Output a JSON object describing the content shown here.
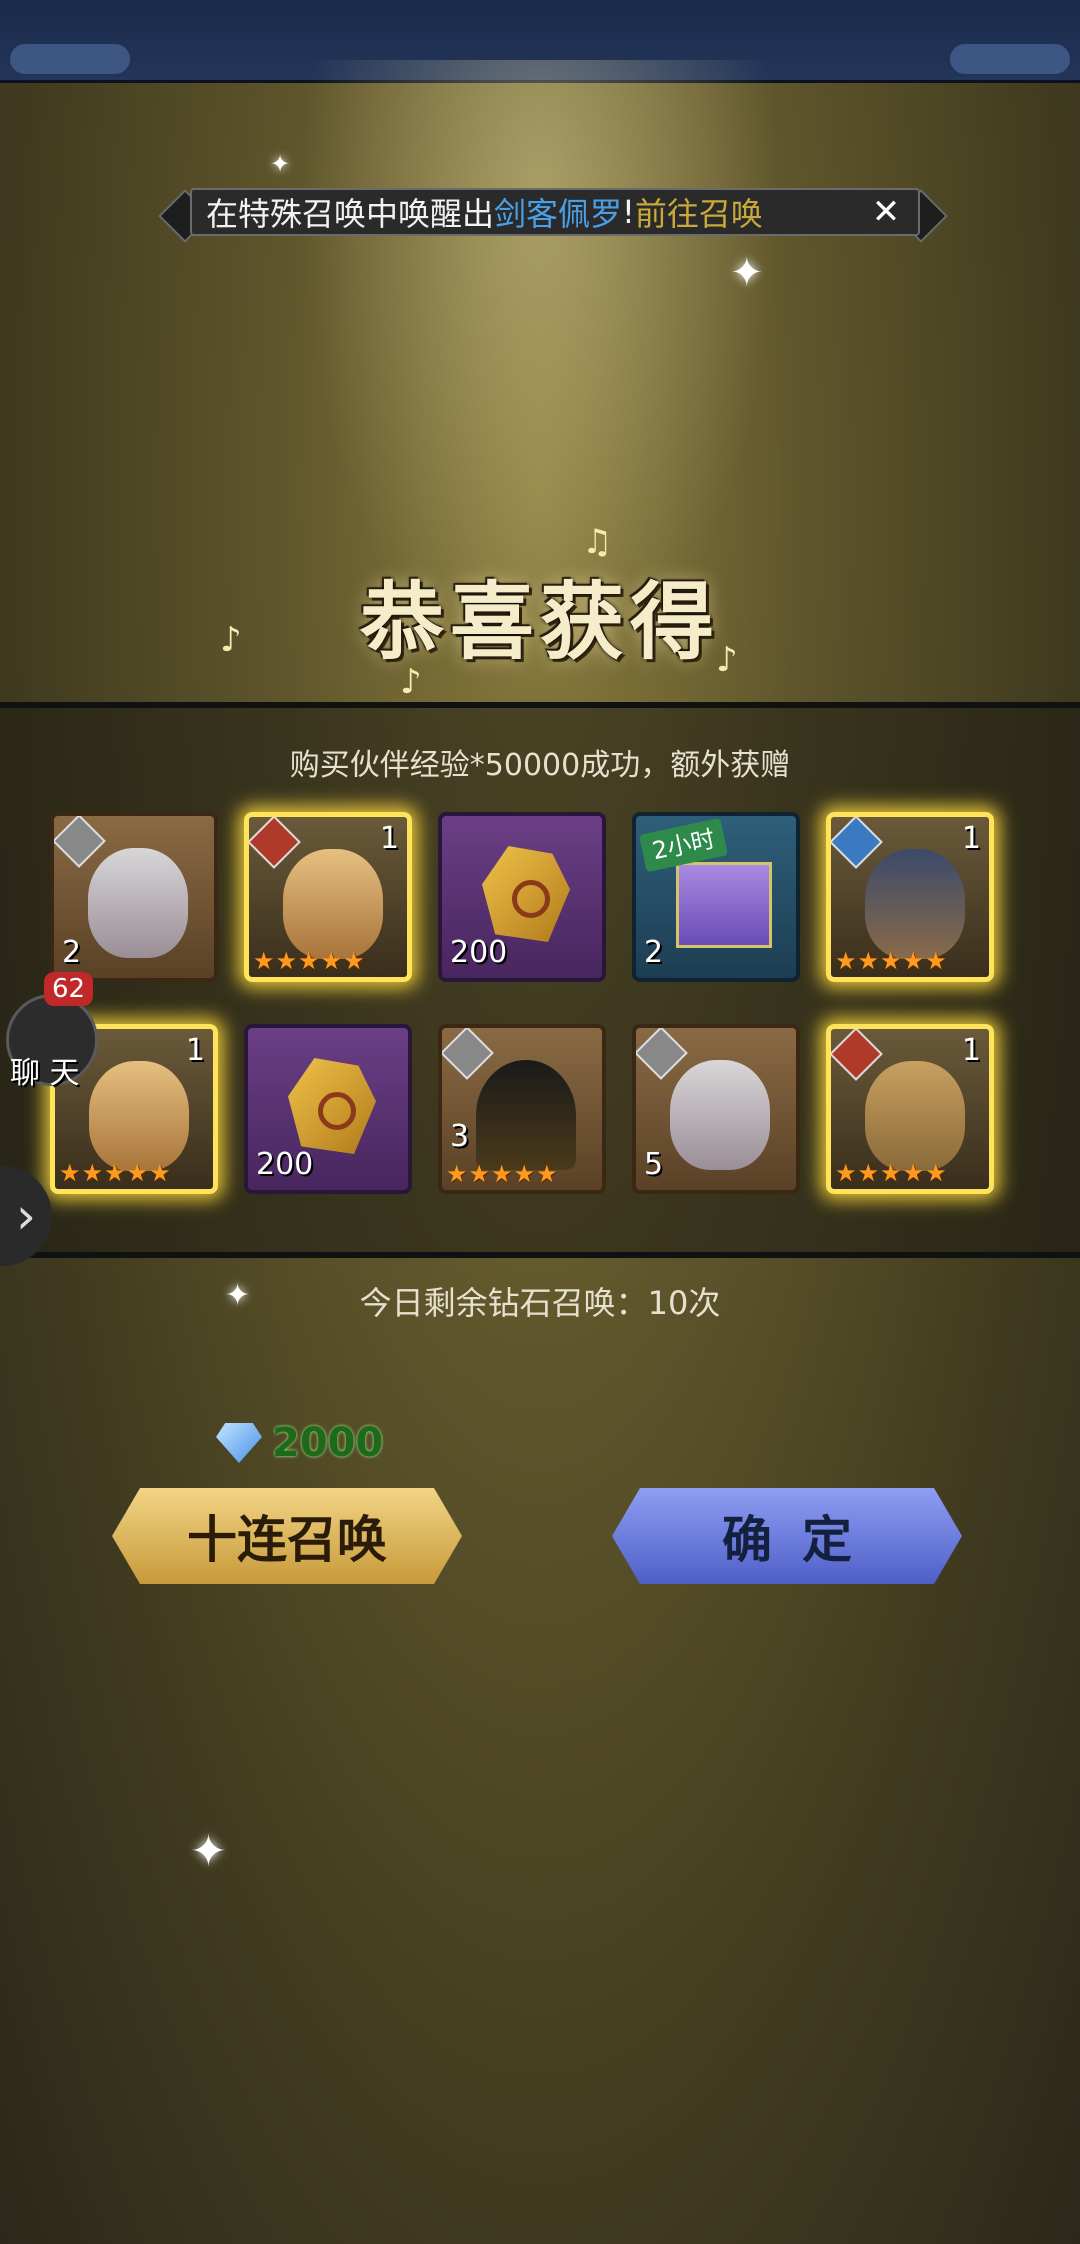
{
  "notice": {
    "prefix": "在特殊召唤中唤醒出",
    "hero": "剑客佩罗",
    "excl": "!",
    "link": "前往召唤"
  },
  "title": "恭喜获得",
  "subtitle": "购买伙伴经验*50000成功，额外获赠",
  "items": [
    {
      "type": "hero-fragment",
      "qty": "2",
      "element": "neutral"
    },
    {
      "type": "hero",
      "count": "1",
      "element": "fire",
      "stars": "★★★★★"
    },
    {
      "type": "ore",
      "qty": "200"
    },
    {
      "type": "exp-gift",
      "qty": "2",
      "tag": "2小时"
    },
    {
      "type": "hero",
      "count": "1",
      "element": "water",
      "stars": "★★★★★"
    },
    {
      "type": "hero",
      "count": "1",
      "element": "fire",
      "stars": "★★★★★"
    },
    {
      "type": "ore",
      "qty": "200"
    },
    {
      "type": "hero-fragment",
      "qty": "3",
      "element": "neutral",
      "stars": "★★★★★"
    },
    {
      "type": "hero-fragment",
      "qty": "5",
      "element": "neutral"
    },
    {
      "type": "hero",
      "count": "1",
      "element": "fire",
      "stars": "★★★★★"
    }
  ],
  "remaining": "今日剩余钻石召唤：10次",
  "cost": "2000",
  "buttons": {
    "ten_summon": "十连召唤",
    "confirm": "确定"
  },
  "chat": {
    "badge": "62",
    "label": "聊 天"
  },
  "colors": {
    "accent_gold": "#f2d486",
    "accent_blue": "#6f7ee0",
    "glow": "#ffe35a"
  }
}
